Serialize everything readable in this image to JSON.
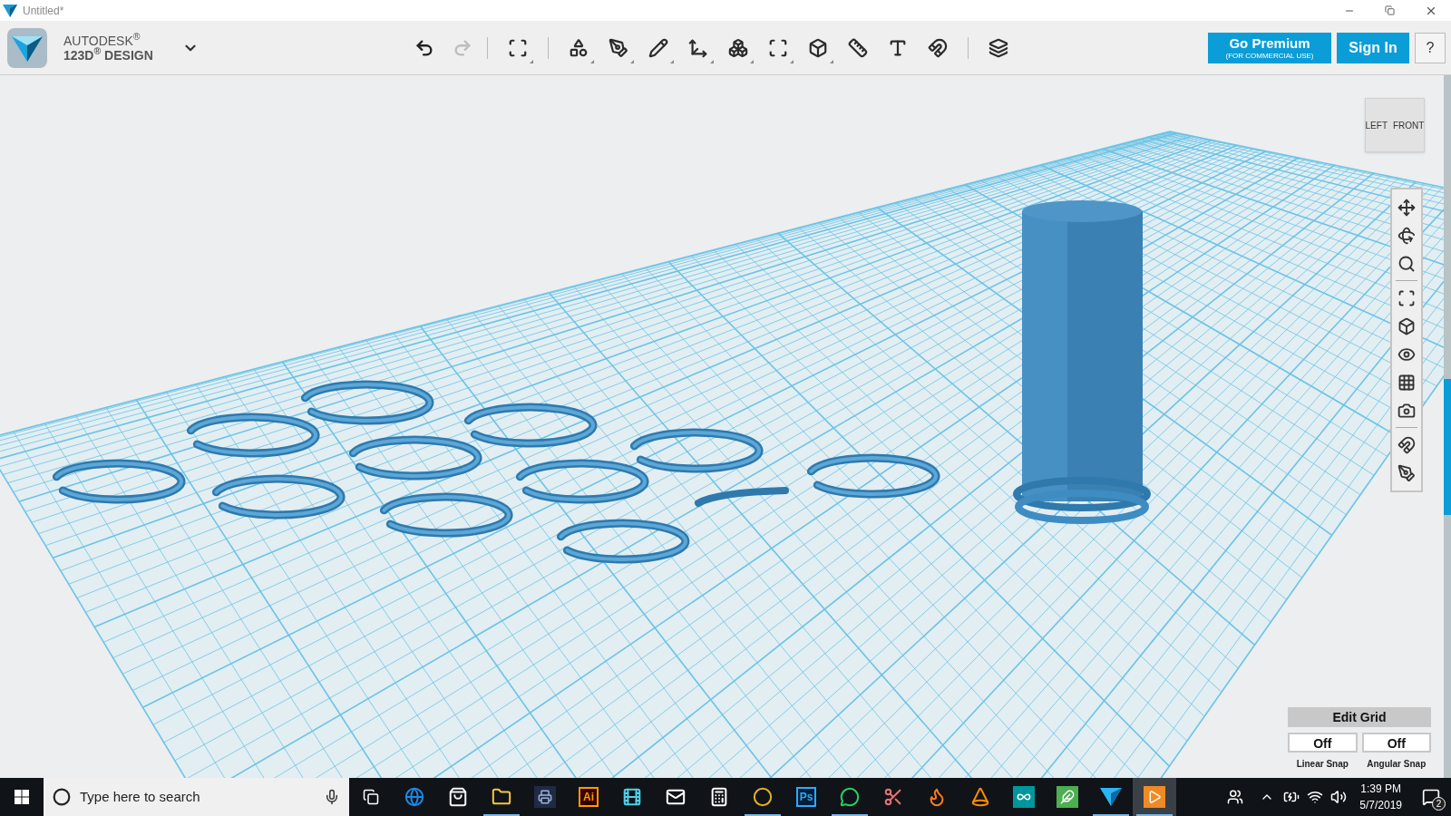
{
  "window": {
    "title": "Untitled*"
  },
  "brand": {
    "line1": "AUTODESK$^{®}$",
    "line2": "123D$^{®}$ DESIGN"
  },
  "history": [
    {
      "kind": "undo",
      "disabled": false
    },
    {
      "kind": "redo",
      "disabled": true
    }
  ],
  "tool_groups": [
    [
      {
        "kind": "snap-box",
        "dropdown": true
      }
    ],
    [
      {
        "kind": "primitives",
        "dropdown": true
      },
      {
        "kind": "sketch",
        "dropdown": true
      },
      {
        "kind": "construct",
        "dropdown": true
      },
      {
        "kind": "modify",
        "dropdown": true
      },
      {
        "kind": "pattern",
        "dropdown": true
      },
      {
        "kind": "grouping",
        "dropdown": true
      },
      {
        "kind": "combine",
        "dropdown": true
      },
      {
        "kind": "measure",
        "dropdown": false
      },
      {
        "kind": "text",
        "dropdown": false
      },
      {
        "kind": "snap",
        "dropdown": false
      }
    ],
    [
      {
        "kind": "material",
        "dropdown": false
      }
    ]
  ],
  "premium": {
    "label": "Go Premium",
    "note": "(FOR COMMERCIAL USE)"
  },
  "sign_in": "Sign In",
  "help": "?",
  "view_cube": {
    "left": "LEFT",
    "front": "FRONT"
  },
  "nav_tools": [
    [
      {
        "kind": "pan"
      },
      {
        "kind": "orbit"
      },
      {
        "kind": "zoom"
      }
    ],
    [
      {
        "kind": "fit"
      },
      {
        "kind": "view-mode"
      },
      {
        "kind": "visibility"
      },
      {
        "kind": "grid-visibility"
      },
      {
        "kind": "camera"
      }
    ],
    [
      {
        "kind": "snap-objects"
      },
      {
        "kind": "hide-sketch"
      }
    ]
  ],
  "grid_panel": {
    "title": "Edit Grid",
    "snaps": [
      {
        "value": "Off",
        "label": "Linear Snap"
      },
      {
        "value": "Off",
        "label": "Angular Snap"
      }
    ]
  },
  "taskbar": {
    "search_placeholder": "Type here to search",
    "apps": [
      {
        "kind": "edge",
        "running": false,
        "active": false
      },
      {
        "kind": "store",
        "running": false,
        "active": false
      },
      {
        "kind": "explorer",
        "running": true,
        "active": false
      },
      {
        "kind": "printer",
        "running": false,
        "active": false
      },
      {
        "kind": "illustrator",
        "label": "Ai",
        "running": false,
        "active": false
      },
      {
        "kind": "movie",
        "running": false,
        "active": false
      },
      {
        "kind": "mail",
        "running": false,
        "active": false
      },
      {
        "kind": "calculator",
        "running": false,
        "active": false
      },
      {
        "kind": "chrome",
        "running": true,
        "active": false
      },
      {
        "kind": "photoshop",
        "label": "Ps",
        "running": false,
        "active": false
      },
      {
        "kind": "whatsapp",
        "running": true,
        "active": false
      },
      {
        "kind": "snipping",
        "running": false,
        "active": false
      },
      {
        "kind": "firefox",
        "running": false,
        "active": false
      },
      {
        "kind": "vlc",
        "running": false,
        "active": false
      },
      {
        "kind": "arduino",
        "running": false,
        "active": false
      },
      {
        "kind": "draw",
        "running": false,
        "active": false
      },
      {
        "kind": "design-app",
        "running": true,
        "active": false
      },
      {
        "kind": "player",
        "running": true,
        "active": true
      }
    ],
    "time": "1:39 PM",
    "date": "5/7/2019",
    "notifications": "2"
  }
}
